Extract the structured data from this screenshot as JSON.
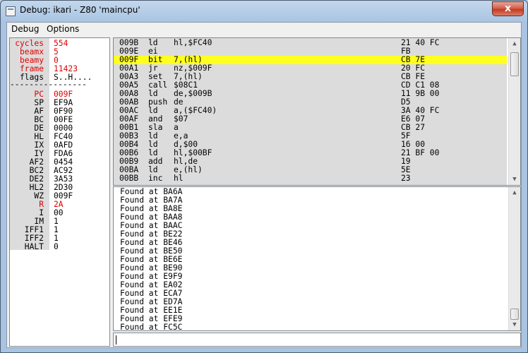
{
  "window": {
    "title": "Debug: ikari - Z80 'maincpu'",
    "close_label": "x"
  },
  "menu": [
    {
      "label": "Debug"
    },
    {
      "label": "Options"
    }
  ],
  "registers": [
    {
      "name": "cycles",
      "value": "554",
      "name_red": true,
      "value_red": true
    },
    {
      "name": "beamx",
      "value": "5",
      "name_red": true,
      "value_red": true
    },
    {
      "name": "beamy",
      "value": "0",
      "name_red": true,
      "value_red": true
    },
    {
      "name": "frame",
      "value": "11423",
      "name_red": true,
      "value_red": true
    },
    {
      "name": "flags",
      "value": "S..H....",
      "name_red": false,
      "value_red": false
    },
    {
      "name": "PC",
      "value": "009F",
      "name_red": true,
      "value_red": true
    },
    {
      "name": "SP",
      "value": "EF9A",
      "name_red": false,
      "value_red": false
    },
    {
      "name": "AF",
      "value": "0F90",
      "name_red": false,
      "value_red": false
    },
    {
      "name": "BC",
      "value": "00FE",
      "name_red": false,
      "value_red": false
    },
    {
      "name": "DE",
      "value": "0000",
      "name_red": false,
      "value_red": false
    },
    {
      "name": "HL",
      "value": "FC40",
      "name_red": false,
      "value_red": false
    },
    {
      "name": "IX",
      "value": "0AFD",
      "name_red": false,
      "value_red": false
    },
    {
      "name": "IY",
      "value": "FDA6",
      "name_red": false,
      "value_red": false
    },
    {
      "name": "AF2",
      "value": "0454",
      "name_red": false,
      "value_red": false
    },
    {
      "name": "BC2",
      "value": "AC92",
      "name_red": false,
      "value_red": false
    },
    {
      "name": "DE2",
      "value": "3A53",
      "name_red": false,
      "value_red": false
    },
    {
      "name": "HL2",
      "value": "2D30",
      "name_red": false,
      "value_red": false
    },
    {
      "name": "WZ",
      "value": "009F",
      "name_red": false,
      "value_red": false
    },
    {
      "name": "R",
      "value": "2A",
      "name_red": true,
      "value_red": true
    },
    {
      "name": "I",
      "value": "00",
      "name_red": false,
      "value_red": false
    },
    {
      "name": "IM",
      "value": "1",
      "name_red": false,
      "value_red": false
    },
    {
      "name": "IFF1",
      "value": "1",
      "name_red": false,
      "value_red": false
    },
    {
      "name": "IFF2",
      "value": "1",
      "name_red": false,
      "value_red": false
    },
    {
      "name": "HALT",
      "value": "0",
      "name_red": false,
      "value_red": false
    }
  ],
  "separator": "----------------",
  "disasm": [
    {
      "addr": "009B",
      "mnem": "ld",
      "ops": "hl,$FC40",
      "bytes": "21 40 FC",
      "current": false
    },
    {
      "addr": "009E",
      "mnem": "ei",
      "ops": "",
      "bytes": "FB",
      "current": false
    },
    {
      "addr": "009F",
      "mnem": "bit",
      "ops": "7,(hl)",
      "bytes": "CB 7E",
      "current": true
    },
    {
      "addr": "00A1",
      "mnem": "jr",
      "ops": "nz,$009F",
      "bytes": "20 FC",
      "current": false
    },
    {
      "addr": "00A3",
      "mnem": "set",
      "ops": "7,(hl)",
      "bytes": "CB FE",
      "current": false
    },
    {
      "addr": "00A5",
      "mnem": "call",
      "ops": "$08C1",
      "bytes": "CD C1 08",
      "current": false
    },
    {
      "addr": "00A8",
      "mnem": "ld",
      "ops": "de,$009B",
      "bytes": "11 9B 00",
      "current": false
    },
    {
      "addr": "00AB",
      "mnem": "push",
      "ops": "de",
      "bytes": "D5",
      "current": false
    },
    {
      "addr": "00AC",
      "mnem": "ld",
      "ops": "a,($FC40)",
      "bytes": "3A 40 FC",
      "current": false
    },
    {
      "addr": "00AF",
      "mnem": "and",
      "ops": "$07",
      "bytes": "E6 07",
      "current": false
    },
    {
      "addr": "00B1",
      "mnem": "sla",
      "ops": "a",
      "bytes": "CB 27",
      "current": false
    },
    {
      "addr": "00B3",
      "mnem": "ld",
      "ops": "e,a",
      "bytes": "5F",
      "current": false
    },
    {
      "addr": "00B4",
      "mnem": "ld",
      "ops": "d,$00",
      "bytes": "16 00",
      "current": false
    },
    {
      "addr": "00B6",
      "mnem": "ld",
      "ops": "hl,$00BF",
      "bytes": "21 BF 00",
      "current": false
    },
    {
      "addr": "00B9",
      "mnem": "add",
      "ops": "hl,de",
      "bytes": "19",
      "current": false
    },
    {
      "addr": "00BA",
      "mnem": "ld",
      "ops": "e,(hl)",
      "bytes": "5E",
      "current": false
    },
    {
      "addr": "00BB",
      "mnem": "inc",
      "ops": "hl",
      "bytes": "23",
      "current": false
    }
  ],
  "console": [
    "Found at BA6A",
    "Found at BA7A",
    "Found at BA8E",
    "Found at BAA8",
    "Found at BAAC",
    "Found at BE22",
    "Found at BE46",
    "Found at BE50",
    "Found at BE6E",
    "Found at BE90",
    "Found at E9F9",
    "Found at EA02",
    "Found at ECA7",
    "Found at ED7A",
    "Found at EE1E",
    "Found at EFE9",
    "Found at FC5C"
  ],
  "command_input": {
    "value": ""
  },
  "colors": {
    "highlight": "#ffff20",
    "red_text": "#e00000",
    "shade": "#dcdcdc"
  }
}
